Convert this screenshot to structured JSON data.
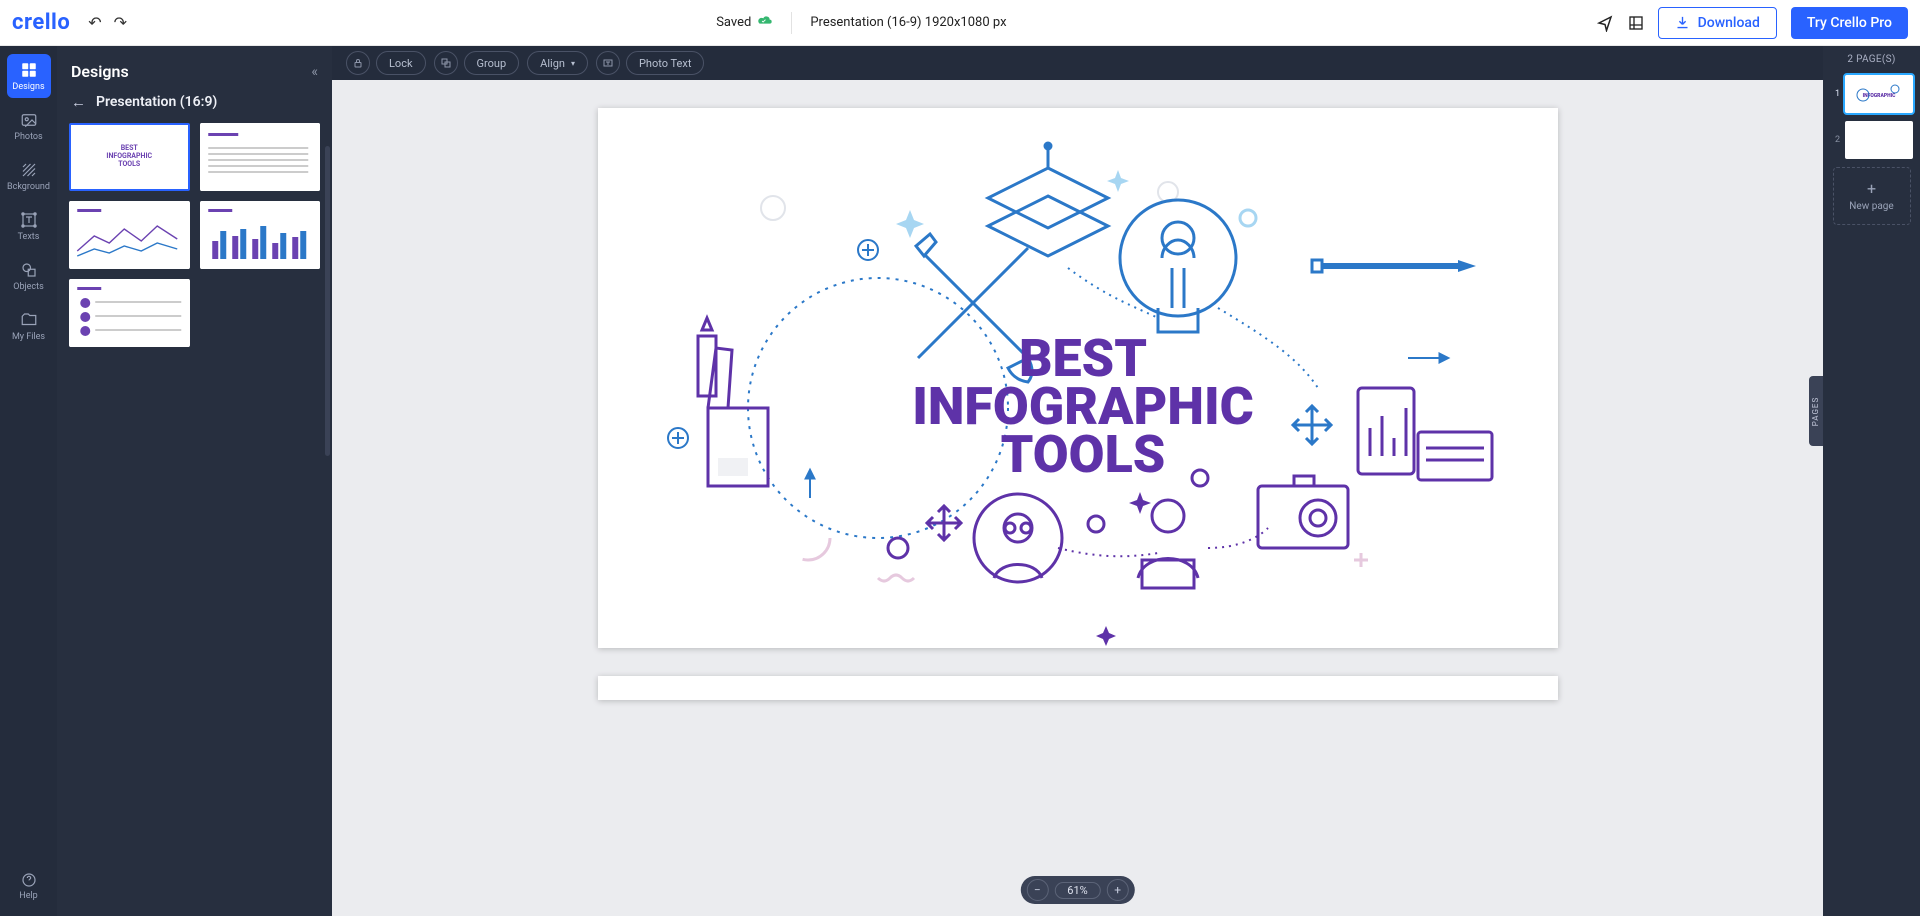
{
  "app": {
    "name": "crello"
  },
  "header": {
    "saved_status": "Saved",
    "doc_title": "Presentation (16-9) 1920x1080 px",
    "download_label": "Download",
    "pro_label": "Try Crello Pro"
  },
  "tool_rail": {
    "items": [
      {
        "key": "designs",
        "label": "Designs"
      },
      {
        "key": "photos",
        "label": "Photos"
      },
      {
        "key": "bckground",
        "label": "Bckground"
      },
      {
        "key": "texts",
        "label": "Texts"
      },
      {
        "key": "objects",
        "label": "Objects"
      },
      {
        "key": "myfiles",
        "label": "My Files"
      }
    ],
    "help_label": "Help"
  },
  "side_panel": {
    "title": "Designs",
    "subtitle": "Presentation (16:9)",
    "templates": [
      {
        "label": "BEST\nINFOGRAPHIC\nTOOLS"
      },
      {
        "label": ""
      },
      {
        "label": ""
      },
      {
        "label": ""
      },
      {
        "label": ""
      }
    ]
  },
  "context_toolbar": {
    "lock": "Lock",
    "group": "Group",
    "align": "Align",
    "photo_text": "Photo Text"
  },
  "canvas": {
    "title_line1": "BEST",
    "title_line2": "INFOGRAPHIC",
    "title_line3": "TOOLS",
    "colors": {
      "blue": "#2b78c8",
      "purple": "#5e32a8",
      "lightblue": "#a7d6f2",
      "pink": "#e6c9de"
    }
  },
  "zoom": {
    "value": "61%"
  },
  "pages_rail": {
    "count_label": "2 PAGE(S)",
    "pages": [
      {
        "num": "1"
      },
      {
        "num": "2"
      }
    ],
    "new_page_label": "New page",
    "tab_label": "PAGES"
  }
}
